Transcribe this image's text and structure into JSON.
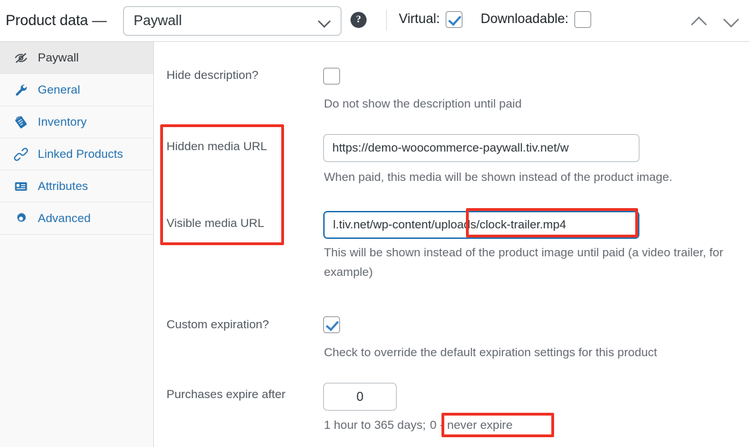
{
  "header": {
    "title": "Product data —",
    "product_type": "Paywall",
    "product_type_options": [
      "Paywall"
    ],
    "help_icon": "help-circle-icon",
    "dropdown_icon": "chevron-down-icon",
    "virtual": {
      "label": "Virtual:",
      "checked": true
    },
    "downloadable": {
      "label": "Downloadable:",
      "checked": false
    },
    "collapse_up_icon": "chevron-up-icon",
    "collapse_down_icon": "chevron-down-icon"
  },
  "sidebar": {
    "items": [
      {
        "label": "Paywall",
        "icon": "eye-slash-icon",
        "active": true
      },
      {
        "label": "General",
        "icon": "wrench-icon",
        "active": false
      },
      {
        "label": "Inventory",
        "icon": "clipboard-icon",
        "active": false
      },
      {
        "label": "Linked Products",
        "icon": "link-icon",
        "active": false
      },
      {
        "label": "Attributes",
        "icon": "list-box-icon",
        "active": false
      },
      {
        "label": "Advanced",
        "icon": "gear-icon",
        "active": false
      }
    ]
  },
  "fields": {
    "hide_description": {
      "label": "Hide description?",
      "checked": false,
      "help": "Do not show the description until paid"
    },
    "hidden_media_url": {
      "label": "Hidden media URL",
      "value": "https://demo-woocommerce-paywall.tiv.net/w",
      "help": "When paid, this media will be shown instead of the product image."
    },
    "visible_media_url": {
      "label": "Visible media URL",
      "value": "l.tiv.net/wp-content/uploads/clock-trailer.mp4",
      "help": "This will be shown instead of the product image until paid (a video trailer, for example)",
      "focused": true
    },
    "custom_expiration": {
      "label": "Custom expiration?",
      "checked": true,
      "help": "Check to override the default expiration settings for this product"
    },
    "purchases_expire_after": {
      "label": "Purchases expire after",
      "value": "0",
      "help_prefix": "1 hour to 365 days;",
      "help_highlight": "0 - never expire"
    }
  },
  "annotations": {
    "color": "#ee3224",
    "boxes": [
      {
        "name": "media-url-labels-highlight",
        "target": "Hidden media URL / Visible media URL labels"
      },
      {
        "name": "clock-trailer-path-highlight",
        "target": "uploads/clock-trailer.mp4"
      },
      {
        "name": "never-expire-highlight",
        "target": "0 - never expire"
      }
    ]
  }
}
